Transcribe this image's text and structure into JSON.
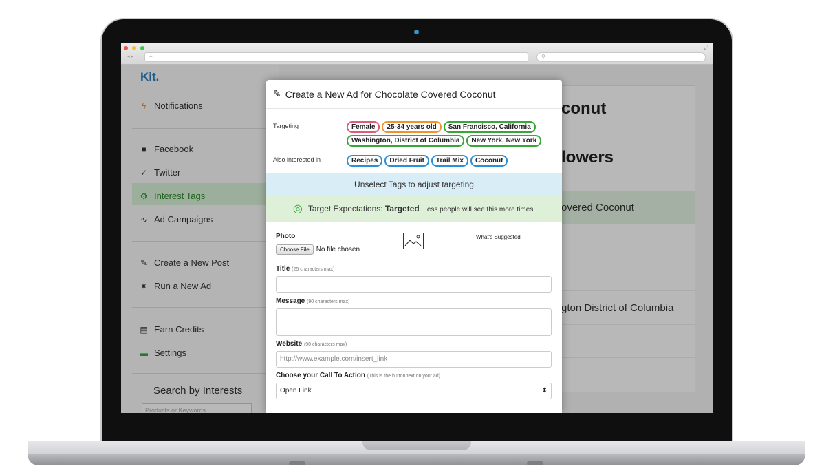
{
  "sidebar": {
    "logo": "Kit.",
    "items": [
      {
        "label": "Notifications",
        "icon": "lightning-icon"
      },
      {
        "label": "Facebook",
        "icon": "facebook-icon"
      },
      {
        "label": "Twitter",
        "icon": "twitter-icon"
      },
      {
        "label": "Interest Tags",
        "icon": "gear-icon"
      },
      {
        "label": "Ad Campaigns",
        "icon": "trend-icon"
      },
      {
        "label": "Create a New Post",
        "icon": "edit-icon"
      },
      {
        "label": "Run a New Ad",
        "icon": "wand-icon"
      },
      {
        "label": "Earn Credits",
        "icon": "credits-icon"
      },
      {
        "label": "Settings",
        "icon": "settings-icon"
      }
    ],
    "search_label": "Search by Interests",
    "search_placeholder": "Products or Keywords"
  },
  "background": {
    "heading1": "conut",
    "heading2": "lowers",
    "row_green": "overed Coconut",
    "row_location": "gton District of Columbia"
  },
  "modal": {
    "title": "Create a New Ad for Chocolate Covered Coconut",
    "targeting_label": "Targeting",
    "targeting_tags": [
      {
        "label": "Female",
        "color": "#e05a7a"
      },
      {
        "label": "25-34 years old",
        "color": "#f0932b"
      },
      {
        "label": "San Francisco, California",
        "color": "#3aa63a"
      },
      {
        "label": "Washington, District of Columbia",
        "color": "#3aa63a"
      },
      {
        "label": "New York, New York",
        "color": "#3aa63a"
      }
    ],
    "interests_label": "Also interested in",
    "interest_tags": [
      {
        "label": "Recipes",
        "color": "#2a8fd6"
      },
      {
        "label": "Dried Fruit",
        "color": "#2a8fd6"
      },
      {
        "label": "Trail Mix",
        "color": "#2a8fd6"
      },
      {
        "label": "Coconut",
        "color": "#2a8fd6"
      }
    ],
    "info_text": "Unselect Tags to adjust targeting",
    "expect_prefix": "Target Expectations: ",
    "expect_bold": "Targeted",
    "expect_suffix": ". Less people will see this more times.",
    "photo_label": "Photo",
    "choose_file": "Choose File",
    "no_file": "No file chosen",
    "whats_suggested": "What's Suggested",
    "title_label": "Title",
    "title_hint": "(25 characters max)",
    "message_label": "Message",
    "message_hint": "(90 characters max)",
    "website_label": "Website",
    "website_hint": "(90 characters max)",
    "website_placeholder": "http://www.example.com/insert_link",
    "cta_label": "Choose your Call To Action",
    "cta_hint": "(This is the button text on your ad)",
    "cta_value": "Open Link"
  }
}
